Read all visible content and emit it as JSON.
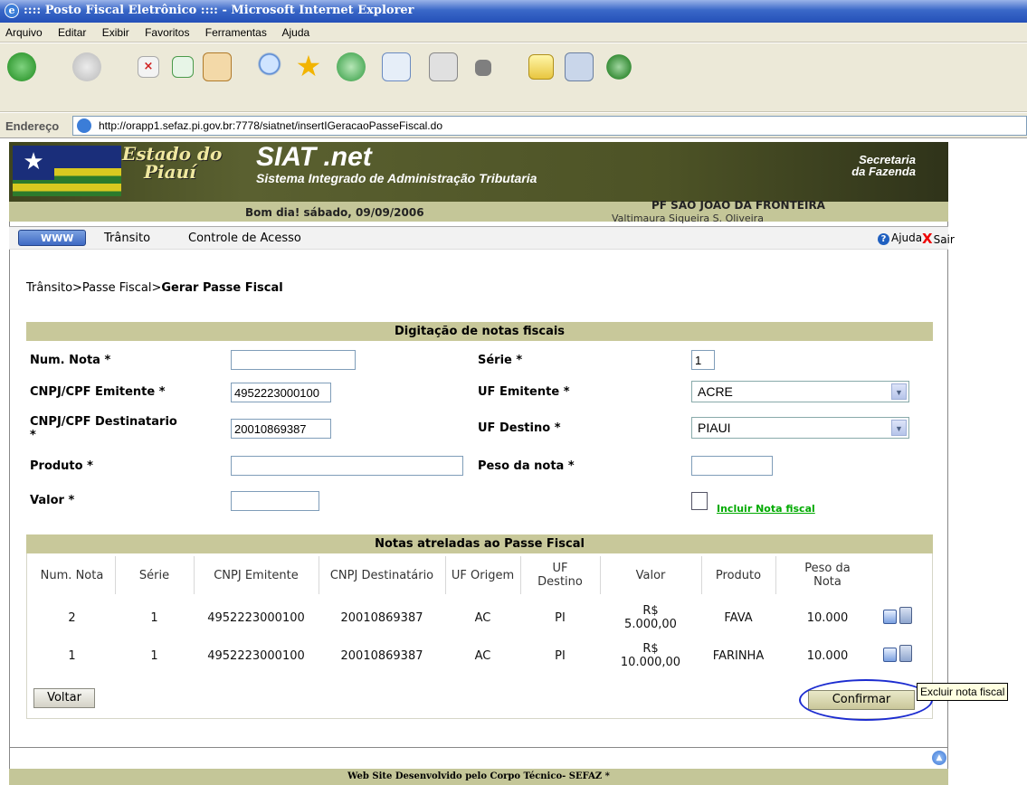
{
  "window": {
    "title": ":::: Posto Fiscal Eletrônico :::: - Microsoft Internet Explorer"
  },
  "menu": [
    "Arquivo",
    "Editar",
    "Exibir",
    "Favoritos",
    "Ferramentas",
    "Ajuda"
  ],
  "address": {
    "label": "Endereço",
    "url": "http://orapp1.sefaz.pi.gov.br:7778/siatnet/insertIGeracaoPasseFiscal.do"
  },
  "banner": {
    "state_line1": "Estado do",
    "state_line2": "Piauí",
    "app_name": "SIAT .net",
    "app_subtitle": "Sistema Integrado de Administração Tributaria",
    "secretaria_line1": "Secretaria",
    "secretaria_line2": "da Fazenda",
    "greeting": "Bom dia! sábado, 09/09/2006",
    "post": "PF SAO JOAO DA FRONTEIRA",
    "user": "Valtimaura Siqueira S. Oliveira"
  },
  "nav": {
    "www": "WWW",
    "transito": "Trânsito",
    "controle": "Controle de Acesso",
    "ajuda": "Ajuda",
    "sair": "Sair"
  },
  "breadcrumb": {
    "path": "Trânsito>Passe Fiscal>",
    "current": "Gerar Passe Fiscal"
  },
  "form": {
    "title": "Digitação de notas fiscais",
    "num_nota_label": "Num. Nota *",
    "num_nota_value": "",
    "serie_label": "Série *",
    "serie_value": "1",
    "cnpj_emit_label": "CNPJ/CPF Emitente *",
    "cnpj_emit_value": "4952223000100",
    "uf_emit_label": "UF Emitente *",
    "uf_emit_value": "ACRE",
    "cnpj_dest_label": "CNPJ/CPF Destinatario",
    "cnpj_dest_label2": "*",
    "cnpj_dest_value": "20010869387",
    "uf_dest_label": "UF Destino *",
    "uf_dest_value": "PIAUI",
    "produto_label": "Produto *",
    "produto_value": "",
    "peso_label": "Peso da nota *",
    "peso_value": "",
    "valor_label": "Valor *",
    "valor_value": "",
    "incluir_label": "Incluir Nota fiscal"
  },
  "table": {
    "title": "Notas atreladas ao Passe Fiscal",
    "headers": {
      "num_nota": "Num. Nota",
      "serie": "Série",
      "cnpj_emit": "CNPJ Emitente",
      "cnpj_dest": "CNPJ Destinatário",
      "uf_origem": "UF Origem",
      "uf_dest_1": "UF",
      "uf_dest_2": "Destino",
      "valor": "Valor",
      "produto": "Produto",
      "peso_1": "Peso da",
      "peso_2": "Nota"
    },
    "rows": [
      {
        "num": "2",
        "serie": "1",
        "cnpj_emit": "4952223000100",
        "cnpj_dest": "20010869387",
        "uf_origem": "AC",
        "uf_dest": "PI",
        "valor_1": "R$",
        "valor_2": "5.000,00",
        "produto": "FAVA",
        "peso": "10.000"
      },
      {
        "num": "1",
        "serie": "1",
        "cnpj_emit": "4952223000100",
        "cnpj_dest": "20010869387",
        "uf_origem": "AC",
        "uf_dest": "PI",
        "valor_1": "R$",
        "valor_2": "10.000,00",
        "produto": "FARINHA",
        "peso": "10.000"
      }
    ]
  },
  "buttons": {
    "voltar": "Voltar",
    "confirmar": "Confirmar"
  },
  "tooltip": "Excluir nota fiscal",
  "footer": "Web Site Desenvolvido pelo Corpo Técnico- SEFAZ *"
}
